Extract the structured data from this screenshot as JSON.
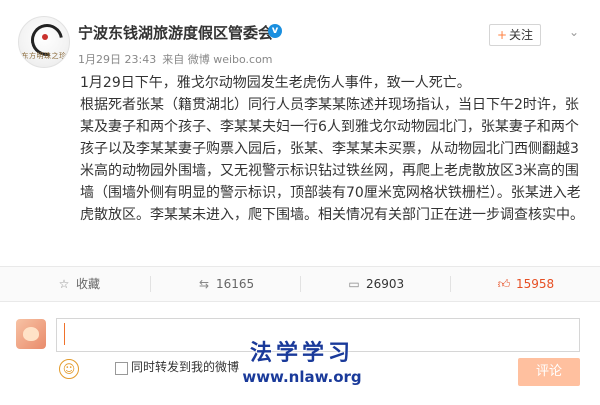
{
  "post": {
    "author": "宁波东钱湖旅游度假区管委会",
    "avatar_caption": "东方明珠之珍",
    "verified_icon": "v",
    "follow_label": "关注",
    "follow_icon": "+",
    "more_icon": "chevron-down-icon",
    "time": "1月29日 23:43",
    "source": "来自 微博 weibo.com",
    "paragraphs": [
      "1月29日下午，雅戈尔动物园发生老虎伤人事件，致一人死亡。",
      "根据死者张某（籍贯湖北）同行人员李某某陈述并现场指认，当日下午2时许，张某及妻子和两个孩子、李某某夫妇一行6人到雅戈尔动物园北门，张某妻子和两个孩子以及李某某妻子购票入园后，张某、李某某未买票，从动物园北门西侧翻越3米高的动物园外围墙，又无视警示标识钻过铁丝网，再爬上老虎散放区3米高的围墙（围墙外侧有明显的警示标识，顶部装有70厘米宽网格状铁栅栏）。张某进入老虎散放区。李某某未进入，爬下围墙。相关情况有关部门正在进一步调查核实中。"
    ]
  },
  "actions": {
    "favorite": {
      "icon": "star-icon",
      "label": "收藏"
    },
    "repost": {
      "icon": "repost-icon",
      "count": "16165"
    },
    "comment": {
      "icon": "comment-icon",
      "count": "26903"
    },
    "like": {
      "icon": "thumbs-up-icon",
      "count": "15958"
    }
  },
  "comment_box": {
    "input_value": "",
    "repost_label": "同时转发到我的微博",
    "submit_label": "评论",
    "emoji_icon": "smiley-icon"
  },
  "watermark": {
    "title": "法学学习",
    "url": "www.nlaw.org"
  },
  "colors": {
    "accent": "#ff8140",
    "like": "#e64f24",
    "verified": "#1a8fdf",
    "submit_disabled": "#ffc09f",
    "watermark": "#1a3a9a"
  }
}
